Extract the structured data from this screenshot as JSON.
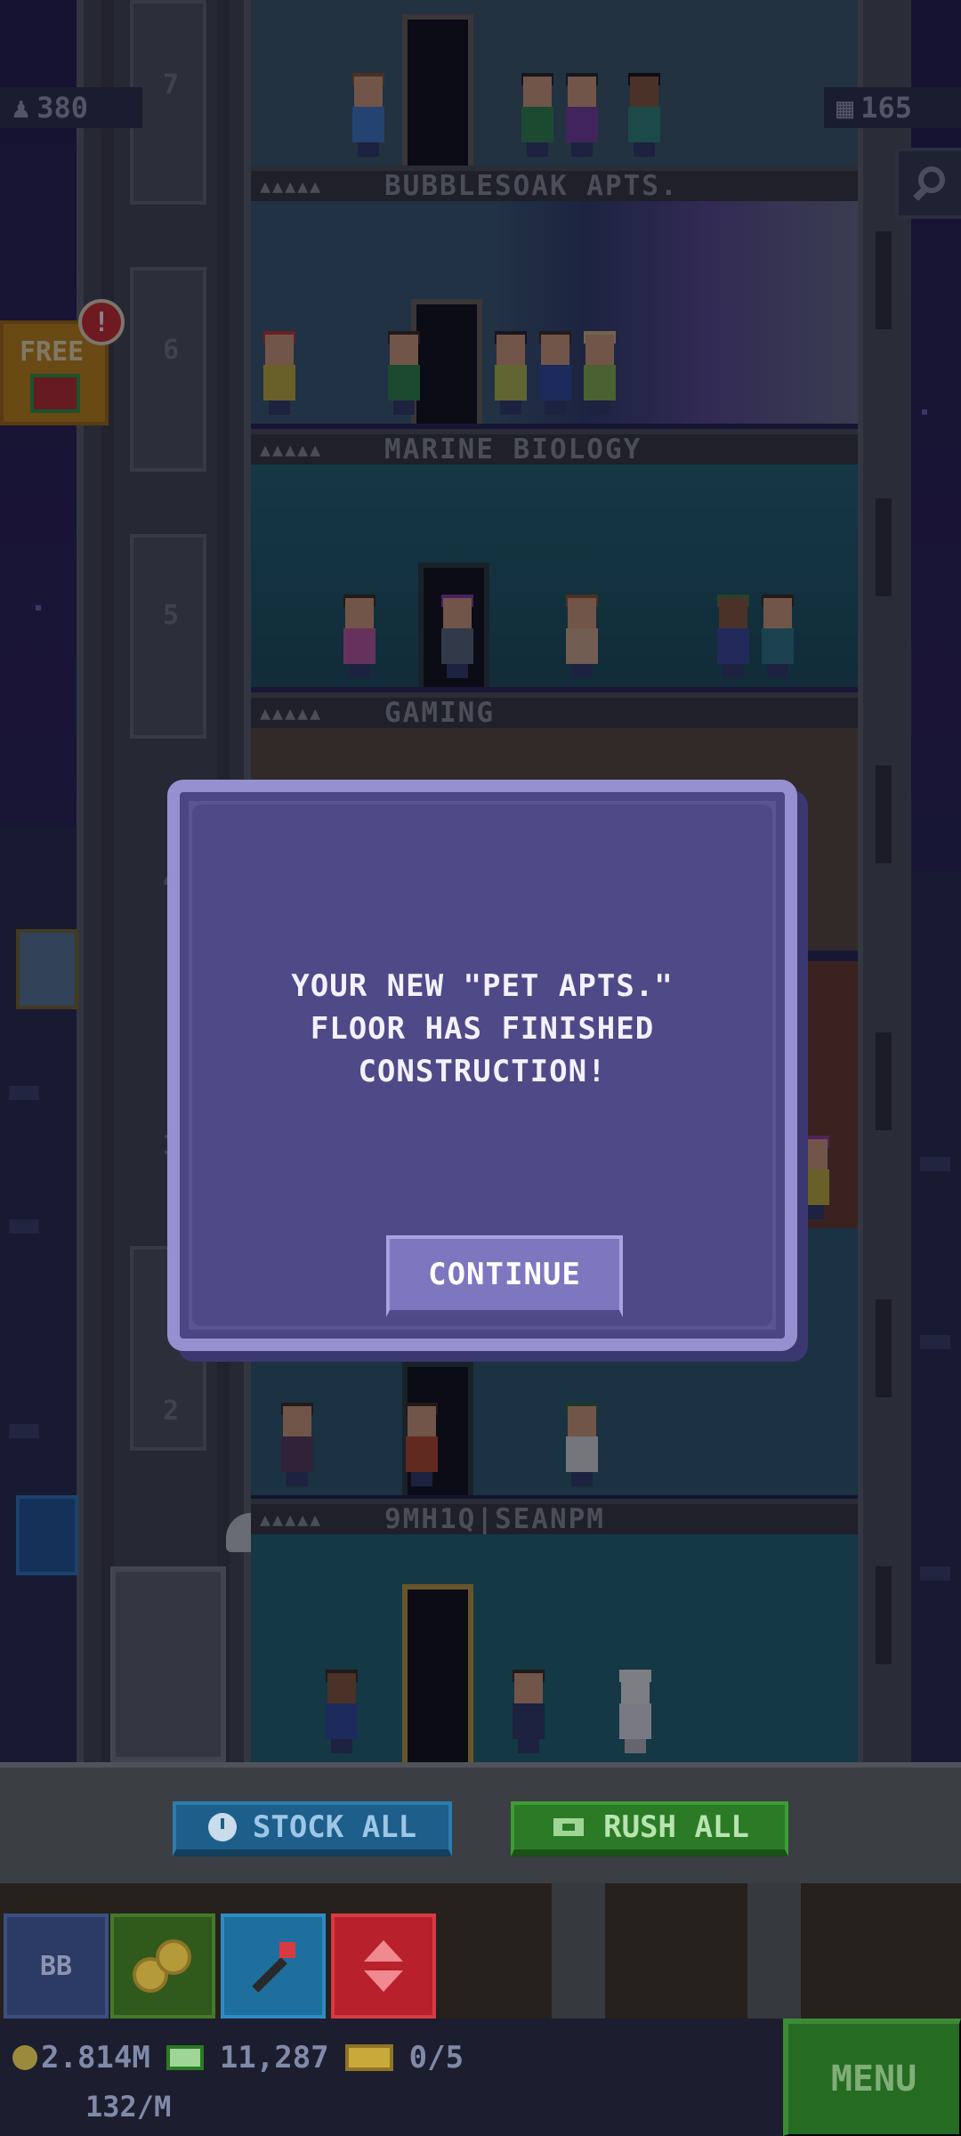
{
  "hud": {
    "population": "380",
    "floor_count": "165",
    "free_label": "FREE",
    "notification_count": "!"
  },
  "elevator_floor_numbers": [
    "7",
    "6",
    "5",
    "4",
    "3",
    "2"
  ],
  "floors": [
    {
      "name": "BUBBLESOAK APTS.",
      "type": "residential"
    },
    {
      "name": "MARINE BIOLOGY",
      "type": "recreation"
    },
    {
      "name": "GAMING",
      "type": "creative"
    },
    {
      "name": "9MH1Q|SEANPM",
      "type": "lobby"
    }
  ],
  "dialog": {
    "message": "YOUR NEW \"PET APTS.\"\nFLOOR HAS FINISHED\nCONSTRUCTION!",
    "continue_label": "CONTINUE"
  },
  "action_bar": {
    "stock_all_label": "STOCK ALL",
    "rush_all_label": "RUSH ALL"
  },
  "tools": {
    "bitbook_label": "BB"
  },
  "status": {
    "coins": "2.814M",
    "bux": "11,287",
    "tickets": "0/5",
    "rate": "132/M",
    "menu_label": "MENU"
  },
  "colors": {
    "dialog_bg": "#4e4a87",
    "dialog_border": "#9690d0",
    "stock_blue": "#1d5e8a",
    "rush_green": "#2b7a25",
    "menu_green": "#256b22"
  },
  "icons": [
    "person-icon",
    "floors-icon",
    "search-icon",
    "gift-icon",
    "clock-icon",
    "money-icon",
    "coins-icon",
    "wand-icon",
    "elevator-icon",
    "ticket-icon"
  ]
}
